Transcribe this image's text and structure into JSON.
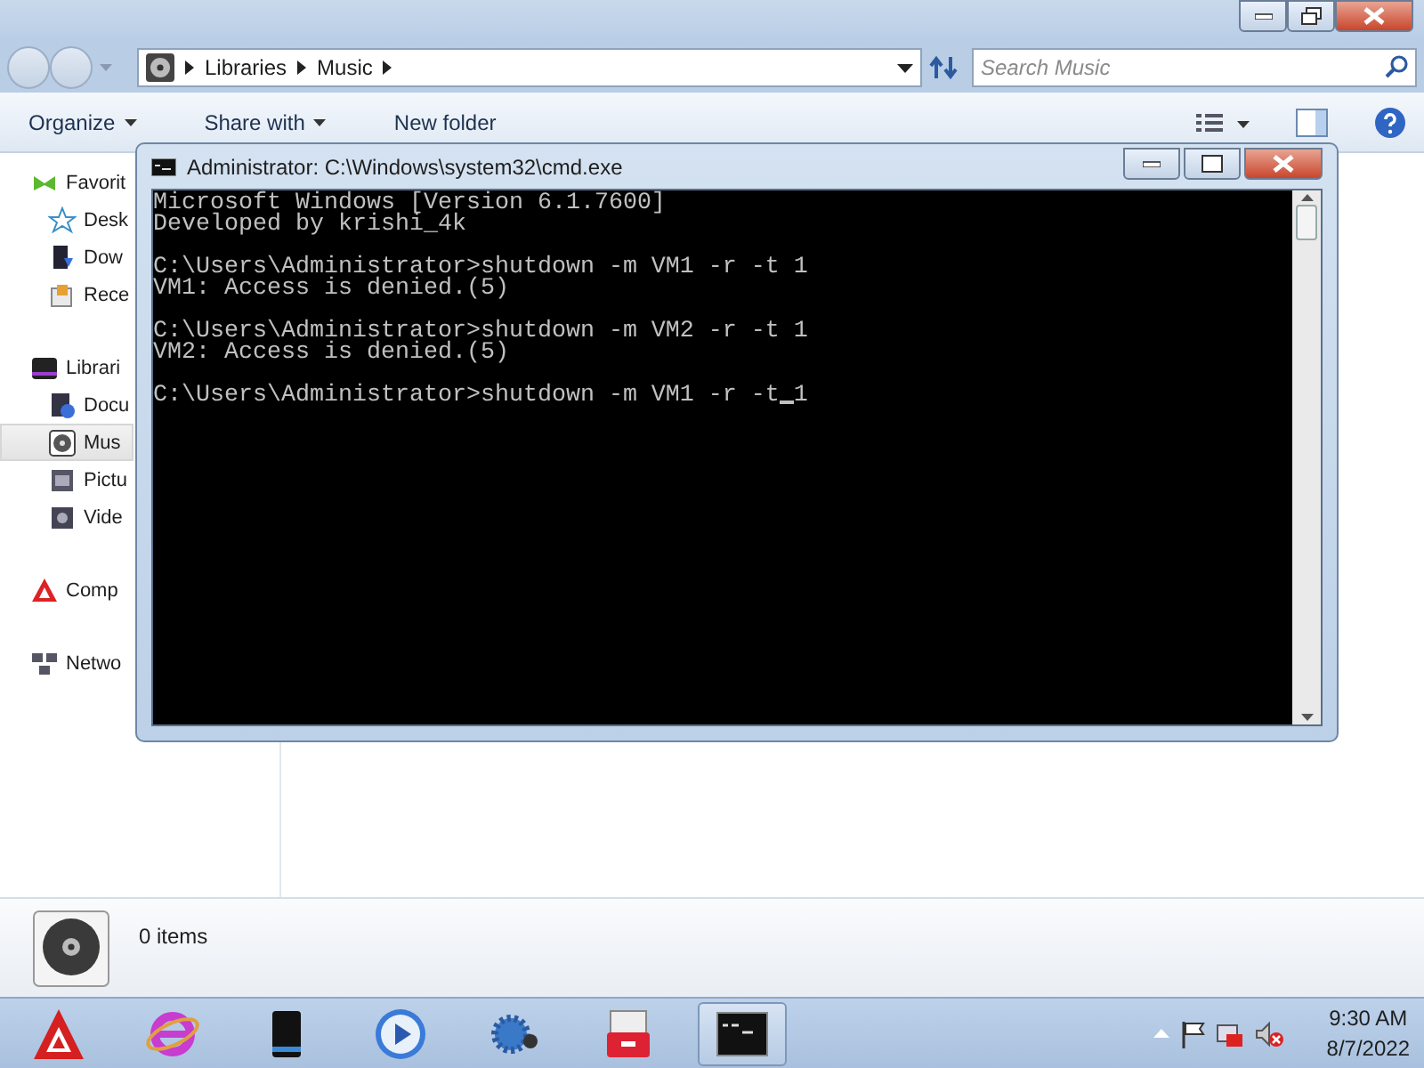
{
  "explorer": {
    "breadcrumbs": [
      "Libraries",
      "Music"
    ],
    "search": {
      "placeholder": "Search Music"
    },
    "toolbar": [
      {
        "label": "Organize",
        "dropdown": true
      },
      {
        "label": "Share with",
        "dropdown": true
      },
      {
        "label": "New folder",
        "dropdown": false
      }
    ],
    "nav": [
      {
        "label": "Favorit",
        "kind": "favorites",
        "selected": false,
        "children": [
          {
            "label": "Desk",
            "kind": "desktop",
            "selected": false
          },
          {
            "label": "Dow",
            "kind": "downloads",
            "selected": false
          },
          {
            "label": "Rece",
            "kind": "recent",
            "selected": false
          }
        ]
      },
      {
        "label": "Librari",
        "kind": "libraries",
        "selected": false,
        "children": [
          {
            "label": "Docu",
            "kind": "documents",
            "selected": false
          },
          {
            "label": "Mus",
            "kind": "music",
            "selected": true
          },
          {
            "label": "Pictu",
            "kind": "pictures",
            "selected": false
          },
          {
            "label": "Vide",
            "kind": "videos",
            "selected": false
          }
        ]
      },
      {
        "label": "Comp",
        "kind": "computer",
        "selected": false
      },
      {
        "label": "Netwo",
        "kind": "network",
        "selected": false
      }
    ],
    "details": {
      "count": "0 items"
    }
  },
  "console": {
    "title": "Administrator: C:\\Windows\\system32\\cmd.exe",
    "blocks": [
      [
        "Microsoft Windows [Version 6.1.7600]",
        "Developed by krishi_4k"
      ],
      [
        "C:\\Users\\Administrator>shutdown -m VM1 -r -t 1",
        "VM1: Access is denied.(5)"
      ],
      [
        "C:\\Users\\Administrator>shutdown -m VM2 -r -t 1",
        "VM2: Access is denied.(5)"
      ]
    ],
    "input_before_cursor": "C:\\Users\\Administrator>shutdown -m VM1 -r -t",
    "input_after_cursor": "1"
  },
  "taskbar": {
    "apps": [
      {
        "kind": "browser",
        "active": false
      },
      {
        "kind": "drive",
        "active": false
      },
      {
        "kind": "player",
        "active": false
      },
      {
        "kind": "gear",
        "active": false
      },
      {
        "kind": "toolbox",
        "active": false
      },
      {
        "kind": "console",
        "active": true
      }
    ],
    "time": "9:30 AM",
    "date": "8/7/2022"
  }
}
